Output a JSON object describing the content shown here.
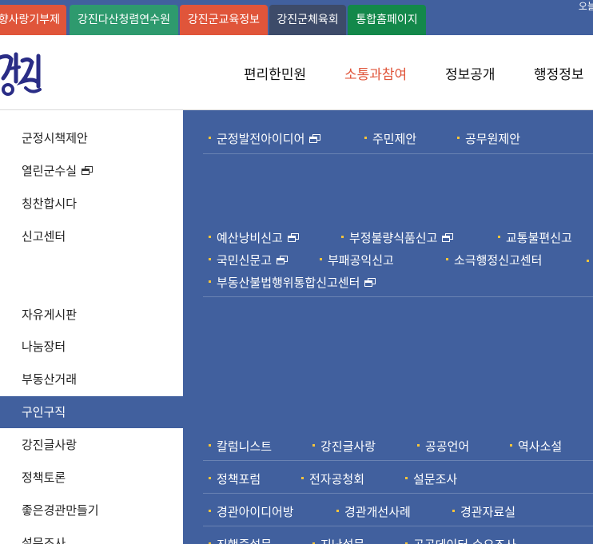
{
  "top_tabs": [
    "향사랑기부제",
    "강진다산청렴연수원",
    "강진군교육정보",
    "강진군체육회",
    "통합홈페이지"
  ],
  "top_right_text": "오늘",
  "logo_text": "강진",
  "gnb": [
    "편리한민원",
    "소통과참여",
    "정보공개",
    "행정정보"
  ],
  "left_menu": [
    "군정시책제안",
    "열린군수실",
    "칭찬합시다",
    "신고센터",
    "자유게시판",
    "나눔장터",
    "부동산거래",
    "구인구직",
    "강진글사랑",
    "정책토론",
    "좋은경관만들기",
    "설문조사"
  ],
  "sub_groups": {
    "proposals": [
      "군정발전아이디어",
      "주민제안",
      "공무원제안"
    ],
    "reports_row1": [
      "예산낭비신고",
      "부정불량식품신고",
      "교통불편신고"
    ],
    "reports_row2": [
      "국민신문고",
      "부패공익신고",
      "소극행정신고센터"
    ],
    "reports_row3": [
      "부동산불법행위통합신고센터"
    ],
    "writing": [
      "칼럼니스트",
      "강진글사랑",
      "공공언어",
      "역사소설"
    ],
    "policy": [
      "정책포럼",
      "전자공청회",
      "설문조사"
    ],
    "landscape": [
      "경관아이디어방",
      "경관개선사례",
      "경관자료실"
    ],
    "survey": [
      "진행중설문",
      "지난설문",
      "공공데이터 수요조사"
    ]
  },
  "colors": {
    "panel_blue": "#41609e",
    "accent_red": "#e0553a",
    "bullet_yellow": "#f5c43a"
  }
}
